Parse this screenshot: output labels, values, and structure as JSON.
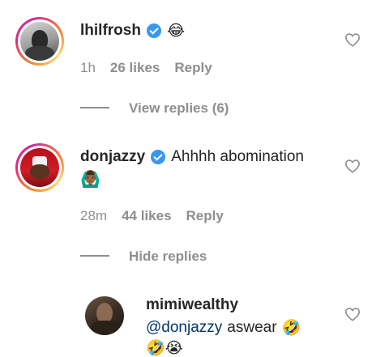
{
  "comments": [
    {
      "username": "lhilfrosh",
      "verified": true,
      "text": "😂",
      "time": "1h",
      "likes": "26 likes",
      "reply": "Reply",
      "replies_toggle": "View replies (6)"
    },
    {
      "username": "donjazzy",
      "verified": true,
      "text": "Ahhhh abomination",
      "text_emoji": "🙆🏾‍♂️",
      "time": "28m",
      "likes": "44 likes",
      "reply": "Reply",
      "replies_toggle": "Hide replies"
    }
  ],
  "reply": {
    "username": "mimiwealthy",
    "mention": "@donjazzy",
    "text": "aswear",
    "emoji_line": "🤣😭",
    "emoji_inline": "🤣"
  },
  "colors": {
    "verified": "#3897f0",
    "meta": "#8e8e8e",
    "mention": "#00376b"
  }
}
